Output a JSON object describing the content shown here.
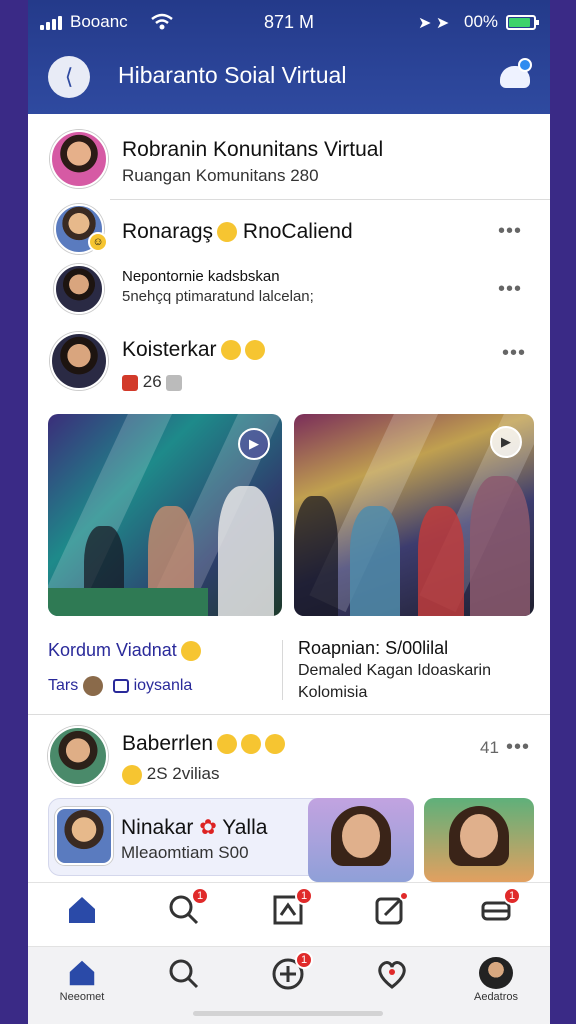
{
  "status": {
    "carrier": "Booanc",
    "time": "871 M",
    "battery": "00%",
    "battery_fraction": 0.8
  },
  "header": {
    "title": "Hibaranto Soial Virtual",
    "back_icon": "back-icon",
    "notification_icon": "bell-icon"
  },
  "community": {
    "name": "Robranin Konunitans Virtual",
    "subtitle": "Ruangan Komunitans 280"
  },
  "items": [
    {
      "name": "Ronaragş",
      "status": "RnoCaliend",
      "more": "•••"
    },
    {
      "name": "Nepontornie kadsbskan",
      "status": "5nehçq ptimaratund lalcelan;",
      "more": "•••"
    },
    {
      "name": "Koisterkar",
      "count": "26",
      "more": "•••"
    }
  ],
  "left_post": {
    "title": "Kordum Viadnat",
    "line": "Tars",
    "line2": "ioysanla"
  },
  "right_post": {
    "title": "Roapnian: S/00lilal",
    "line1": "Demaled Kagan Idoaskarin",
    "line2": "Kolomisia"
  },
  "user_row": {
    "name": "Baberrlen",
    "count": "2S",
    "status": "2vilias",
    "number": "41",
    "more": "•••"
  },
  "card": {
    "name": "Ninakar",
    "name2": "Yalla",
    "subtitle": "Mleaomtiam S00"
  },
  "nav_top": [
    {
      "icon": "home-icon"
    },
    {
      "icon": "search-icon",
      "badge": "1"
    },
    {
      "icon": "post-icon",
      "badge": "1"
    },
    {
      "icon": "edit-icon",
      "badge": ""
    },
    {
      "icon": "chat-icon",
      "badge": "1"
    }
  ],
  "nav_bottom": [
    {
      "icon": "home-icon",
      "label": "Neeomet"
    },
    {
      "icon": "search-icon",
      "label": ""
    },
    {
      "icon": "add-icon",
      "label": "",
      "badge": "1"
    },
    {
      "icon": "heart-icon",
      "label": ""
    },
    {
      "icon": "profile-icon",
      "label": "Aedatros"
    }
  ],
  "colors": {
    "header": "#2f4aa0",
    "accent": "#2a2a9a",
    "badge": "#e02a2a"
  }
}
